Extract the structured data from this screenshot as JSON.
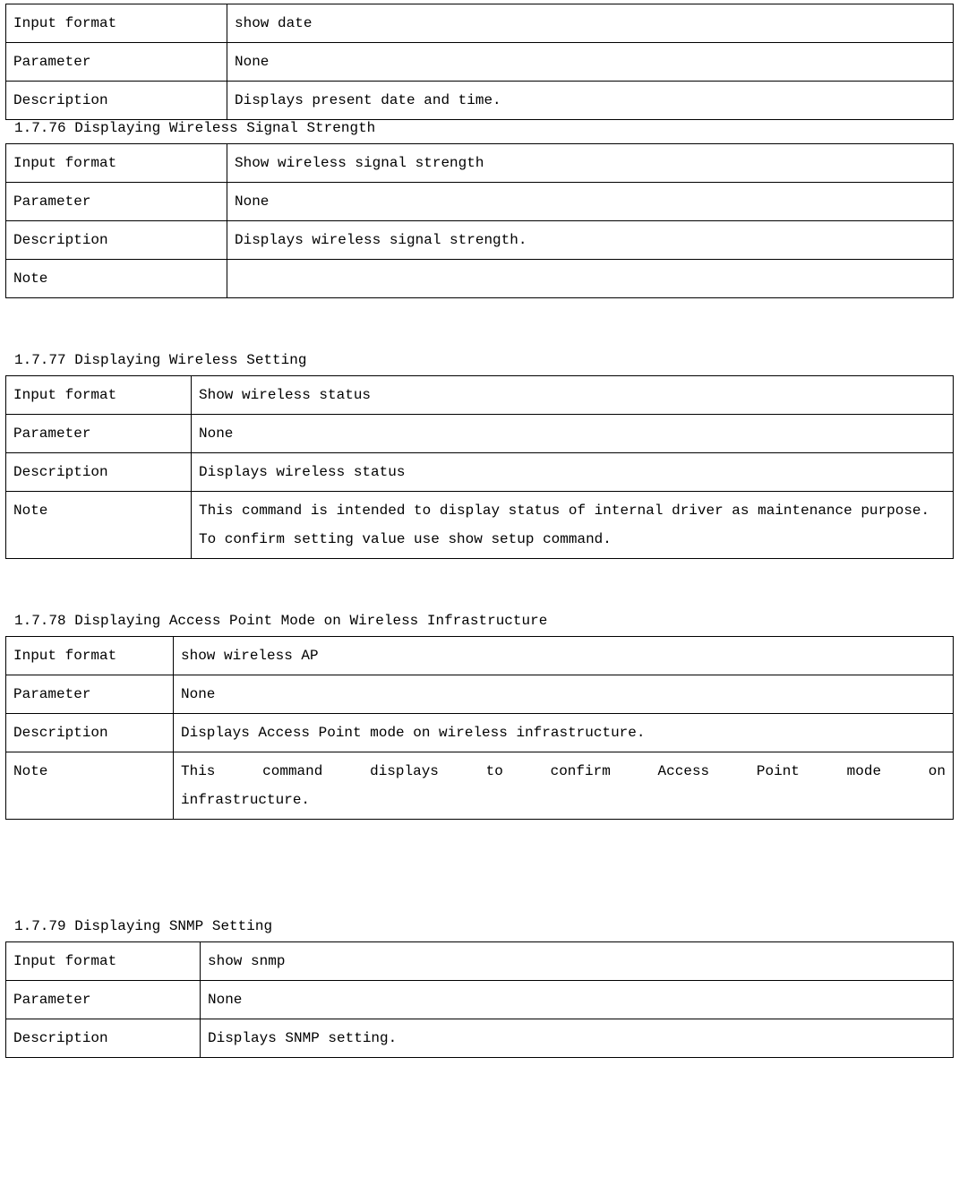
{
  "top_table": {
    "rows": [
      {
        "label": "Input format",
        "value": "show date"
      },
      {
        "label": "Parameter",
        "value": "None"
      },
      {
        "label": "Description",
        "value": "Displays present date and time."
      }
    ]
  },
  "sections": [
    {
      "id": "s76",
      "heading": "1.7.76 Displaying Wireless Signal Strength",
      "rows": [
        {
          "label": "Input format",
          "value": " Show wireless signal strength"
        },
        {
          "label": "Parameter",
          "value": " None"
        },
        {
          "label": "Description",
          "value": "Displays wireless signal strength."
        },
        {
          "label": "Note",
          "value": ""
        }
      ]
    },
    {
      "id": "s77",
      "heading": "1.7.77 Displaying Wireless Setting",
      "rows": [
        {
          "label": "Input format",
          "value": "Show wireless status"
        },
        {
          "label": "Parameter",
          "value": "None"
        },
        {
          "label": "Description",
          "value": "Displays wireless status"
        },
        {
          "label": "Note",
          "value": "This command is intended to display status of internal driver as maintenance purpose. To confirm setting value use show setup command."
        }
      ]
    },
    {
      "id": "s78",
      "heading": "1.7.78 Displaying Access Point Mode on Wireless Infrastructure",
      "rows": [
        {
          "label": "Input format",
          "value": "show wireless AP"
        },
        {
          "label": "Parameter",
          "value": "None"
        },
        {
          "label": "Description",
          "value": "Displays Access Point mode on wireless infrastructure."
        },
        {
          "label": "Note",
          "value": "This command displays to confirm Access Point mode on",
          "justify": true,
          "extra": "infrastructure."
        }
      ]
    },
    {
      "id": "s79",
      "heading": "1.7.79 Displaying SNMP Setting",
      "big_gap": true,
      "rows": [
        {
          "label": "Input format",
          "value": " show snmp"
        },
        {
          "label": "Parameter",
          "value": "None"
        },
        {
          "label": "Description",
          "value": "Displays SNMP setting."
        }
      ]
    }
  ]
}
